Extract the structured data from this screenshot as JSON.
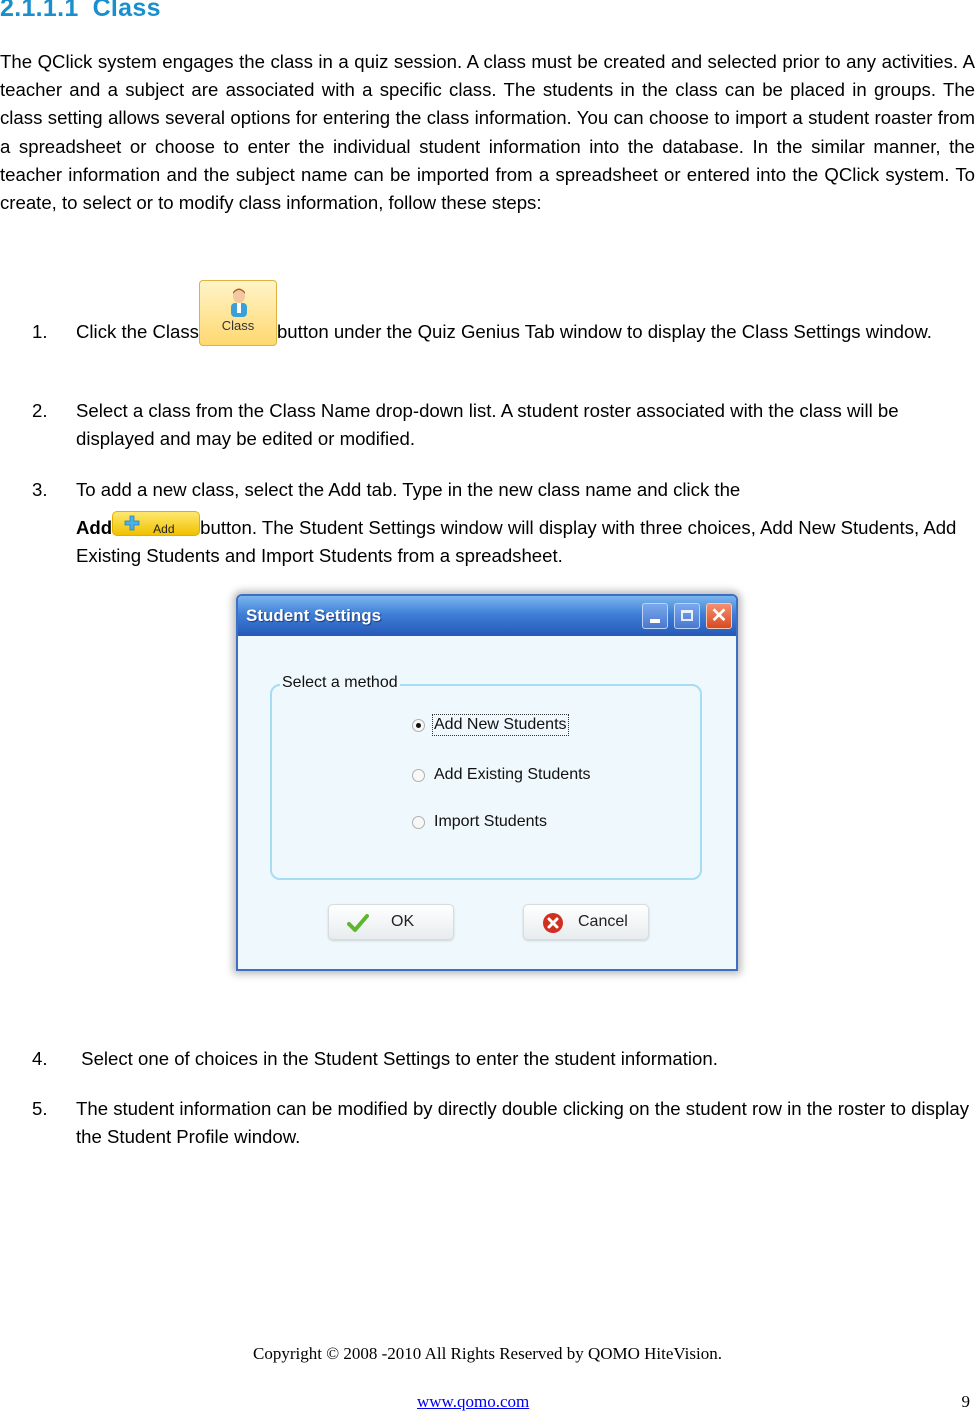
{
  "heading": {
    "number": "2.1.1.1",
    "title": "Class"
  },
  "intro": "The QClick system engages the class in a quiz session. A class must be created and selected prior to any activities. A teacher and a subject are associated with a specific class. The students in the class can be placed in groups. The class setting allows several options for entering the class information. You can choose to import a student roaster from a spreadsheet or choose to enter the individual student information into the database. In the similar manner, the teacher information and the subject name can be imported from a spreadsheet or entered into the QClick system. To create, to select or to modify class information, follow these steps:",
  "steps": [
    {
      "num": "1.",
      "before": "Click the Class",
      "button_label": "Class",
      "after": "button under the Quiz Genius Tab window to display the Class Settings window."
    },
    {
      "num": "2.",
      "text": "Select a class from the Class Name drop-down list. A student roster associated with the class will be displayed and may be edited or modified."
    },
    {
      "num": "3.",
      "line1": "To add a new class, select the Add tab. Type in the new class name and click the",
      "bold": "Add",
      "button_label": "Add",
      "after": "button. The Student Settings window will display with three choices, Add New Students, Add Existing Students and Import Students from a spreadsheet."
    },
    {
      "num": "4.",
      "text": " Select one of choices in the Student Settings to enter the student information."
    },
    {
      "num": "5.",
      "text": "The student information can be modified by directly double clicking on the student row in the roster to display the Student Profile window."
    }
  ],
  "dialog": {
    "title": "Student Settings",
    "group_label": "Select a method",
    "options": [
      {
        "label": "Add New Students",
        "selected": true
      },
      {
        "label": "Add Existing Students",
        "selected": false
      },
      {
        "label": "Import Students",
        "selected": false
      }
    ],
    "ok_label": "OK",
    "cancel_label": "Cancel",
    "close_glyph": "✕"
  },
  "footer": {
    "copyright": "Copyright © 2008 -2010 All Rights Reserved by QOMO HiteVision.",
    "link": "www.qomo.com",
    "page": "9"
  },
  "colors": {
    "heading": "#1a8fd0",
    "titlebar": "#2658b8",
    "link": "#0000ee"
  }
}
